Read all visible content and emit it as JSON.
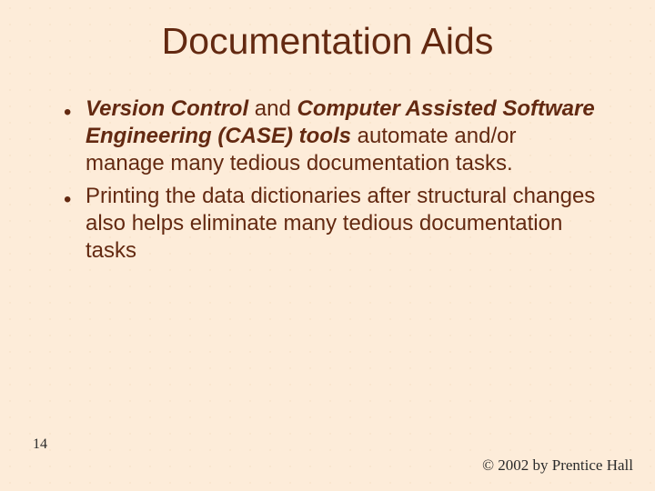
{
  "title": "Documentation Aids",
  "bullets": [
    {
      "runs": [
        {
          "text": "Version Control",
          "style": "bi"
        },
        {
          "text": " and ",
          "style": "plain"
        },
        {
          "text": "Computer Assisted Software Engineering (CASE) tools",
          "style": "bi"
        },
        {
          "text": " automate and/or manage many tedious documentation tasks.",
          "style": "plain"
        }
      ]
    },
    {
      "runs": [
        {
          "text": "Printing the data dictionaries after structural changes also helps eliminate many tedious documentation tasks",
          "style": "plain"
        }
      ]
    }
  ],
  "page_number": "14",
  "copyright": "© 2002 by Prentice Hall"
}
